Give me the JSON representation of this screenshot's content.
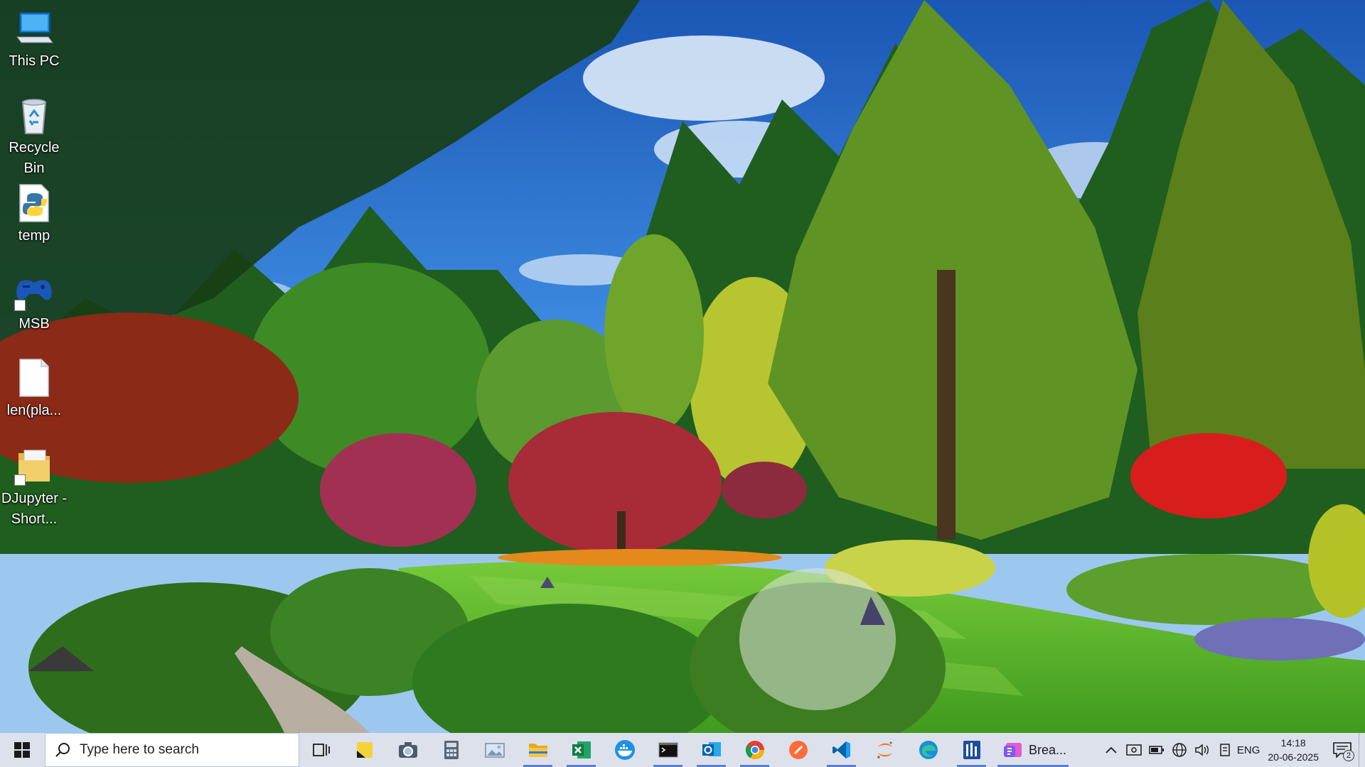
{
  "desktop": {
    "icons": [
      {
        "label": "This PC",
        "icon": "computer-icon"
      },
      {
        "label": "Recycle Bin",
        "icon": "recycle-bin-icon"
      },
      {
        "label": "temp",
        "icon": "python-file-icon"
      },
      {
        "label": "MSB",
        "icon": "gamepad-icon"
      },
      {
        "label": "len(pla...",
        "icon": "text-file-icon"
      },
      {
        "label": "DJupyter - Short...",
        "icon": "folder-shortcut-icon"
      }
    ]
  },
  "taskbar": {
    "search": {
      "placeholder": "Type here to search"
    },
    "apps": [
      {
        "name": "task-view",
        "icon": "task-view-icon"
      },
      {
        "name": "sticky-notes",
        "icon": "sticky-notes-icon"
      },
      {
        "name": "camera",
        "icon": "camera-icon"
      },
      {
        "name": "calculator",
        "icon": "calculator-icon"
      },
      {
        "name": "photos",
        "icon": "photos-icon"
      },
      {
        "name": "file-explorer",
        "icon": "folder-icon"
      },
      {
        "name": "excel",
        "icon": "excel-icon"
      },
      {
        "name": "docker",
        "icon": "whale-icon"
      },
      {
        "name": "terminal",
        "icon": "terminal-icon"
      },
      {
        "name": "outlook",
        "icon": "outlook-icon"
      },
      {
        "name": "chrome",
        "icon": "chrome-icon"
      },
      {
        "name": "postman",
        "icon": "rocket-icon"
      },
      {
        "name": "vscode",
        "icon": "vscode-icon"
      },
      {
        "name": "jupyter",
        "icon": "jupyter-icon"
      },
      {
        "name": "edge",
        "icon": "edge-icon"
      },
      {
        "name": "app",
        "icon": "building-icon"
      }
    ],
    "active_task": {
      "label": "Brea...",
      "icon": "browser-app-icon"
    },
    "tray": {
      "language": "ENG",
      "time": "14:18",
      "date": "20-06-2025",
      "notification_count": "2"
    }
  }
}
